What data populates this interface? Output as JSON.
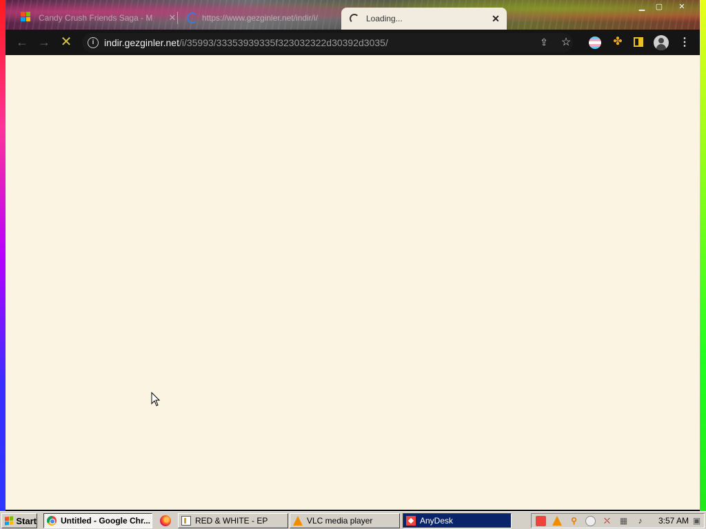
{
  "browser": {
    "tabs": [
      {
        "title": "Candy Crush Friends Saga - M",
        "state": "inactive"
      },
      {
        "title": "https://www.gezginler.net/indir/i/",
        "state": "inactive"
      },
      {
        "title": "Loading...",
        "state": "active-loading"
      }
    ],
    "address": {
      "host": "indir.gezginler.net",
      "path": "/i/35993/33353939335f323032322d30392d3035/"
    },
    "page": {
      "status": "loading",
      "background": "#fbf4e3"
    }
  },
  "taskbar": {
    "start_label": "Start",
    "tasks": [
      {
        "label": "Untitled - Google Chr...",
        "state": "pressed"
      },
      {
        "label": "RED & WHITE - EP",
        "state": "normal"
      },
      {
        "label": "VLC media player",
        "state": "normal"
      },
      {
        "label": "AnyDesk",
        "state": "active"
      }
    ],
    "clock": "3:57 AM"
  },
  "colors": {
    "accent_loading": "#d8c24a",
    "toolbar": "#151515",
    "taskbar": "#d4d0c8",
    "active_task": "#0a246a"
  }
}
